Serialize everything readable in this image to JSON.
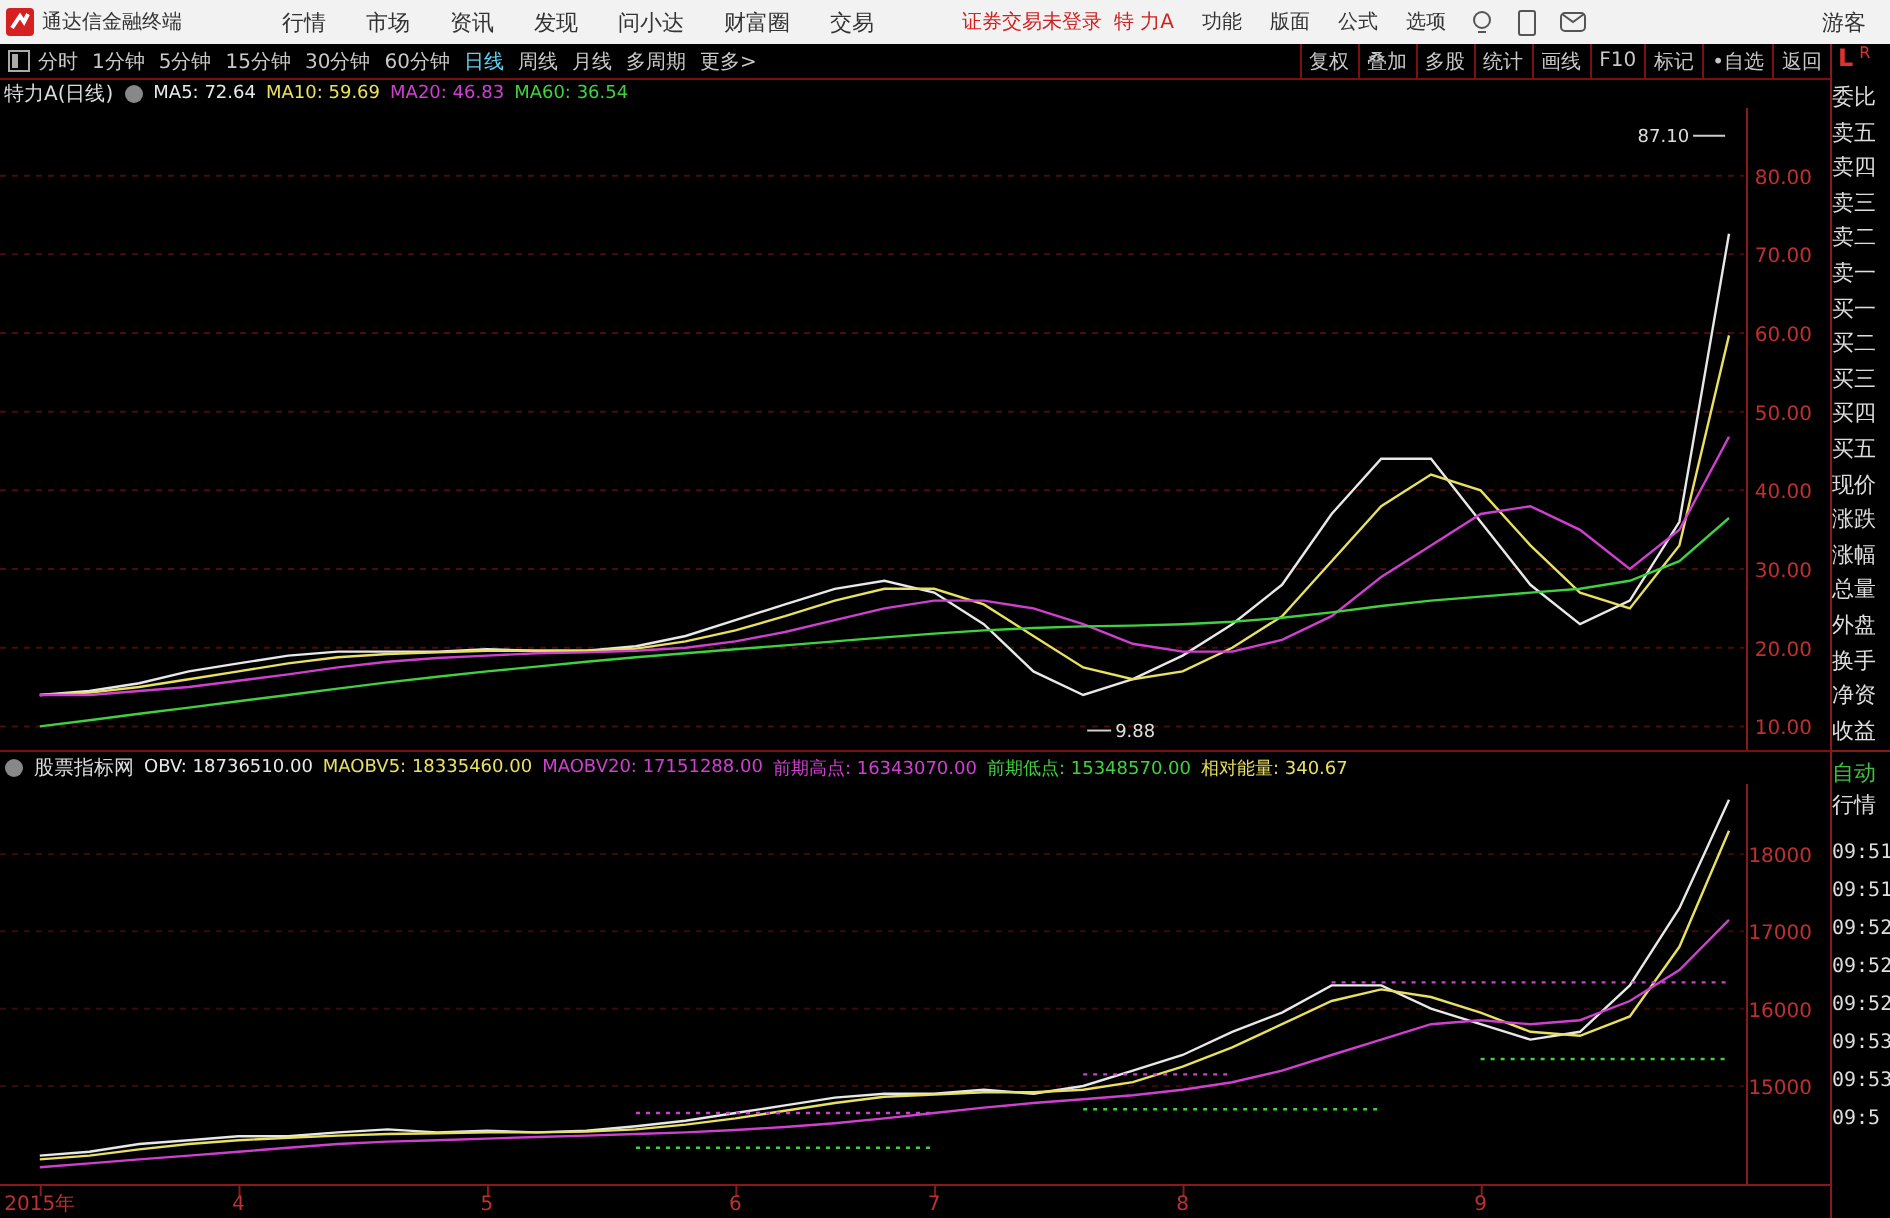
{
  "app_bar": {
    "title": "通达信金融终端",
    "menu": [
      "行情",
      "市场",
      "资讯",
      "发现",
      "问小达",
      "财富圈",
      "交易"
    ],
    "login_status": "证券交易未登录",
    "stock": "特 力A",
    "actions": [
      "功能",
      "版面",
      "公式",
      "选项"
    ],
    "user": "游客"
  },
  "period_tabs": [
    {
      "label": "分时",
      "selected": false
    },
    {
      "label": "1分钟",
      "selected": false
    },
    {
      "label": "5分钟",
      "selected": false
    },
    {
      "label": "15分钟",
      "selected": false
    },
    {
      "label": "30分钟",
      "selected": false
    },
    {
      "label": "60分钟",
      "selected": false
    },
    {
      "label": "日线",
      "selected": true
    },
    {
      "label": "周线",
      "selected": false
    },
    {
      "label": "月线",
      "selected": false
    },
    {
      "label": "多周期",
      "selected": false
    },
    {
      "label": "更多>",
      "selected": false
    }
  ],
  "tool_buttons": [
    "复权",
    "叠加",
    "多股",
    "统计",
    "画线",
    "F10",
    "标记",
    "•自选",
    "返回"
  ],
  "price_panel": {
    "title": "特力A(日线)",
    "legend_values": [
      ": 72.64",
      ": 59.69",
      ": 46.83",
      ": 36.54"
    ],
    "chart_data": {
      "type": "line",
      "categories": [
        null,
        null,
        null,
        null,
        null,
        null,
        null,
        null,
        null,
        null,
        null,
        null,
        null,
        null,
        null,
        null,
        null,
        null,
        null,
        null,
        null,
        null,
        null,
        null,
        null,
        null,
        null,
        null,
        null,
        null,
        null,
        null,
        null,
        null,
        null
      ],
      "ylim": [
        7,
        88.6
      ],
      "grid": true,
      "yticks": [
        {
          "value": 10,
          "label": "10.00"
        },
        {
          "value": 20,
          "label": "20.00"
        },
        {
          "value": 30,
          "label": "30.00"
        },
        {
          "value": 40,
          "label": "40.00"
        },
        {
          "value": 50,
          "label": "50.00"
        },
        {
          "value": 60,
          "label": "60.00"
        },
        {
          "value": 70,
          "label": "70.00"
        },
        {
          "value": 80,
          "label": "80.00"
        }
      ],
      "series": [
        {
          "name": "MA5",
          "color": "#e8e8e8",
          "values": [
            14,
            14.5,
            15.5,
            17,
            18,
            19,
            19.5,
            19.5,
            19.5,
            19.8,
            19.6,
            19.6,
            20.2,
            21.5,
            23.5,
            25.5,
            27.5,
            28.5,
            27,
            23,
            17,
            14,
            16,
            19,
            23,
            28,
            37,
            44,
            44,
            36,
            28,
            23,
            26,
            36,
            72.6
          ]
        },
        {
          "name": "MA10",
          "color": "#e8e060",
          "values": [
            14,
            14.3,
            15,
            16,
            17,
            18,
            18.8,
            19.2,
            19.4,
            19.6,
            19.6,
            19.6,
            19.9,
            20.8,
            22.2,
            24,
            26,
            27.5,
            27.5,
            25.5,
            21.5,
            17.5,
            16,
            17,
            20,
            24,
            31,
            38,
            42,
            40,
            33,
            27,
            25,
            33,
            59.7
          ]
        },
        {
          "name": "MA20",
          "color": "#d040d0",
          "values": [
            14,
            14,
            14.5,
            15,
            15.8,
            16.6,
            17.5,
            18.2,
            18.7,
            19,
            19.3,
            19.4,
            19.6,
            20,
            20.8,
            22,
            23.5,
            25,
            26,
            26,
            25,
            23,
            20.5,
            19.5,
            19.5,
            21,
            24,
            29,
            33,
            37,
            38,
            35,
            30,
            35,
            46.8
          ]
        },
        {
          "name": "MA60",
          "color": "#40d040",
          "values": [
            10,
            10.8,
            11.6,
            12.4,
            13.2,
            14,
            14.8,
            15.6,
            16.3,
            17,
            17.6,
            18.2,
            18.8,
            19.3,
            19.8,
            20.3,
            20.8,
            21.3,
            21.8,
            22.2,
            22.5,
            22.7,
            22.8,
            23,
            23.3,
            23.8,
            24.5,
            25.3,
            26,
            26.5,
            27,
            27.5,
            28.5,
            31,
            36.5
          ]
        }
      ],
      "annotations": [
        {
          "text": "87.10"
        },
        {
          "text": "9.88"
        }
      ]
    }
  },
  "indicator_panel": {
    "title": "股票指标网",
    "legend_values": [
      ": 18736510.00",
      ": 18335460.00",
      ": 17151288.00",
      ": 16343070.00",
      ": 15348570.00"
    ],
    "extra_legend": {
      "text": "相对能量: 340.67",
      "color": "#e8e060"
    },
    "chart_data": {
      "type": "line",
      "categories": [
        "2015年",
        null,
        null,
        null,
        "4",
        null,
        null,
        null,
        null,
        "5",
        null,
        null,
        null,
        null,
        "6",
        null,
        null,
        null,
        "7",
        null,
        null,
        null,
        null,
        "8",
        null,
        null,
        null,
        null,
        null,
        "9",
        null,
        null,
        null,
        null,
        null
      ],
      "ylim": [
        13733,
        18905
      ],
      "grid": true,
      "yticks": [
        15000,
        16000,
        17000,
        18000
      ],
      "series": [
        {
          "name": "OBV",
          "color": "#e8e8e8",
          "values": [
            14100,
            14150,
            14250,
            14300,
            14350,
            14350,
            14400,
            14440,
            14400,
            14420,
            14400,
            14420,
            14480,
            14550,
            14650,
            14750,
            14850,
            14900,
            14900,
            14950,
            14900,
            15000,
            15200,
            15400,
            15700,
            15950,
            16300,
            16300,
            16000,
            15800,
            15600,
            15700,
            16300,
            17300,
            18700
          ]
        },
        {
          "name": "MAOBV5",
          "color": "#e8e060",
          "values": [
            14050,
            14100,
            14180,
            14250,
            14300,
            14330,
            14360,
            14380,
            14390,
            14400,
            14400,
            14410,
            14440,
            14500,
            14580,
            14680,
            14780,
            14860,
            14890,
            14920,
            14920,
            14950,
            15050,
            15250,
            15500,
            15800,
            16100,
            16250,
            16150,
            15950,
            15700,
            15650,
            15900,
            16800,
            18300
          ]
        },
        {
          "name": "MAOBV20",
          "color": "#d040d0",
          "values": [
            13950,
            14000,
            14050,
            14100,
            14150,
            14200,
            14250,
            14280,
            14300,
            14320,
            14340,
            14360,
            14380,
            14400,
            14430,
            14470,
            14520,
            14580,
            14650,
            14720,
            14780,
            14830,
            14880,
            14950,
            15050,
            15200,
            15400,
            15600,
            15800,
            15850,
            15800,
            15850,
            16100,
            16500,
            17150
          ]
        },
        {
          "name": "前期高点",
          "color": "#d040d0",
          "line_style": "dotted",
          "values": [
            null,
            null,
            null,
            null,
            null,
            null,
            null,
            null,
            null,
            null,
            null,
            null,
            14650,
            14650,
            14650,
            14650,
            14650,
            14650,
            14650,
            null,
            null,
            15150,
            15150,
            15150,
            15150,
            null,
            16340,
            16340,
            16340,
            16340,
            16340,
            16340,
            16340,
            16340,
            16340
          ]
        },
        {
          "name": "前期低点",
          "color": "#40d040",
          "line_style": "dotted",
          "values": [
            null,
            null,
            null,
            null,
            null,
            null,
            null,
            null,
            null,
            null,
            null,
            null,
            14200,
            14200,
            14200,
            14200,
            14200,
            14200,
            14200,
            null,
            null,
            14700,
            14700,
            14700,
            14700,
            14700,
            14700,
            14700,
            null,
            15350,
            15350,
            15350,
            15350,
            15350,
            15350
          ]
        }
      ]
    }
  },
  "side_panel": {
    "corner": [
      "L",
      "R"
    ],
    "quote_fields": [
      "委比",
      "卖五",
      "卖四",
      "卖三",
      "卖二",
      "卖一",
      "买一",
      "买二",
      "买三",
      "买四",
      "买五",
      "现价",
      "涨跌",
      "涨幅",
      "总量",
      "外盘",
      "换手",
      "净资",
      "收益"
    ],
    "ticker_title": [
      "自动",
      "行情"
    ],
    "tick_times": [
      "09:51",
      "09:51",
      "09:52",
      "09:52",
      "09:52",
      "09:53",
      "09:53",
      "09:5"
    ]
  }
}
